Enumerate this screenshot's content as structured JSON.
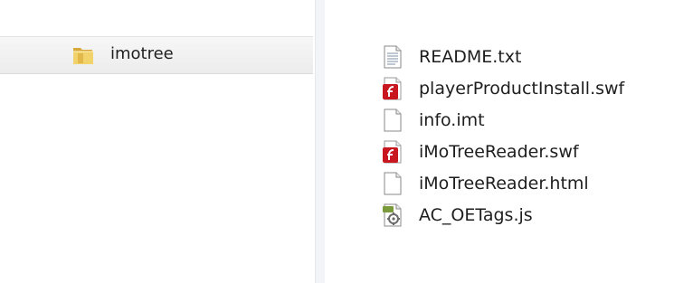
{
  "navigation": {
    "selected_folder": {
      "label": "imotree",
      "icon": "folder-icon"
    }
  },
  "files": [
    {
      "name": "README.txt",
      "icon": "text-file-icon"
    },
    {
      "name": "playerProductInstall.swf",
      "icon": "flash-file-icon"
    },
    {
      "name": "info.imt",
      "icon": "generic-file-icon"
    },
    {
      "name": "iMoTreeReader.swf",
      "icon": "flash-file-icon"
    },
    {
      "name": "iMoTreeReader.html",
      "icon": "generic-file-icon"
    },
    {
      "name": "AC_OETags.js",
      "icon": "script-file-icon"
    }
  ],
  "colors": {
    "selection_background": "#ececec",
    "flash_red": "#c8171e",
    "folder_yellow": "#e8c24a",
    "script_green": "#7a9a3c"
  }
}
